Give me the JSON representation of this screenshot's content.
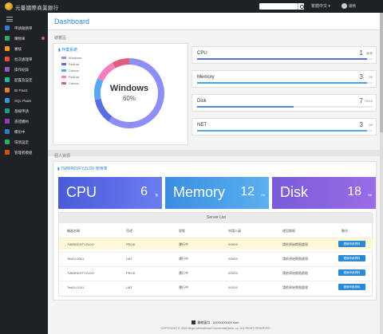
{
  "app": {
    "brand": "元臺國際商業銀行",
    "language": "繁體中文",
    "user": "總務"
  },
  "sidebar": {
    "items": [
      {
        "label": "申請服務單",
        "icon": "form-icon",
        "color": "#3a7bd5",
        "badge": false
      },
      {
        "label": "購物車",
        "icon": "cart-icon",
        "color": "#27ae60",
        "badge": true
      },
      {
        "label": "審核",
        "icon": "check-icon",
        "color": "#f39c12",
        "badge": false
      },
      {
        "label": "批次處理單",
        "icon": "batch-icon",
        "color": "#e74c3c",
        "badge": false
      },
      {
        "label": "操作紀錄",
        "icon": "history-icon",
        "color": "#9b59b6",
        "badge": false
      },
      {
        "label": "配置及設定",
        "icon": "settings-icon",
        "color": "#1abc9c",
        "badge": false
      },
      {
        "label": "BI PaaS",
        "icon": "bi-icon",
        "color": "#e67e22",
        "badge": false
      },
      {
        "label": "SQL PaaS",
        "icon": "sql-icon",
        "color": "#3498db",
        "badge": false
      },
      {
        "label": "基線申請",
        "icon": "baseline-icon",
        "color": "#16a085",
        "badge": false
      },
      {
        "label": "憑證續約",
        "icon": "cert-icon",
        "color": "#8e44ad",
        "badge": false
      },
      {
        "label": "備份中",
        "icon": "backup-icon",
        "color": "#2c80b9",
        "badge": false
      },
      {
        "label": "環境設定",
        "icon": "env-icon",
        "color": "#27ae60",
        "badge": false
      },
      {
        "label": "管理者模組",
        "icon": "admin-icon",
        "color": "#d35400",
        "badge": false
      }
    ]
  },
  "page": {
    "title": "Dashboard",
    "section1": "總覽區",
    "section2": "個人資源"
  },
  "os_card": {
    "title": "作業系統",
    "legend": [
      {
        "label": "Windows",
        "color": "#8e8ef5"
      },
      {
        "label": "Redhat",
        "color": "#5b6ee1"
      },
      {
        "label": "Centos",
        "color": "#5aa9f0"
      },
      {
        "label": "Redhat",
        "color": "#f47fc0"
      },
      {
        "label": "Centos",
        "color": "#e05d7e"
      }
    ],
    "center_label": "Windows",
    "center_pct": "60%"
  },
  "metrics": [
    {
      "name": "CPU",
      "value": "1",
      "unit": "個/核",
      "fill": 0.97,
      "color": "#5b6ee1"
    },
    {
      "name": "Memory",
      "value": "3",
      "unit": "GB",
      "fill": 0.97,
      "color": "#4aa3df"
    },
    {
      "name": "Disk",
      "value": "7",
      "unit": "TB/GB",
      "fill": 0.55,
      "color": "#4a90d9"
    },
    {
      "name": "NET",
      "value": "3",
      "unit": "GB",
      "fill": 0.97,
      "color": "#5aa9f0"
    }
  ],
  "machine": {
    "header": "TWBIRDXFYZLDX 使用率",
    "tiles": [
      {
        "name": "CPU",
        "value": "6",
        "unit": "核",
        "color_from": "#4a5bd9",
        "color_to": "#6a7df0"
      },
      {
        "name": "Memory",
        "value": "12",
        "unit": "GB",
        "color_from": "#3a8ee0",
        "color_to": "#5ab0f0"
      },
      {
        "name": "Disk",
        "value": "18",
        "unit": "GB",
        "color_from": "#7a5bd9",
        "color_to": "#9a6de6"
      }
    ]
  },
  "server_list": {
    "title": "Server List",
    "headers": [
      "機器名稱",
      "用途",
      "狀態",
      "申請人員",
      "使用期限",
      "動作"
    ],
    "rows": [
      {
        "name": "TWBIRDXFYZLDX",
        "purpose": "PROD",
        "status": "運行中",
        "applicant": "0X0X0",
        "expire": "請依原始期限處理",
        "action": "連線申請資料",
        "highlight": true
      },
      {
        "name": "Test1LLDXL",
        "purpose": "UAT",
        "status": "運行中",
        "applicant": "0X0X0",
        "expire": "請依原始期限處理",
        "action": "連線申請資料",
        "highlight": false
      },
      {
        "name": "TWBIRDXFYZLDX",
        "purpose": "PROD",
        "status": "運行中",
        "applicant": "0X0X0",
        "expire": "請依原始期限處理",
        "action": "連線申請資料",
        "highlight": false
      },
      {
        "name": "Test1LLDXL",
        "purpose": "UAT",
        "status": "運行中",
        "applicant": "0X0X0",
        "expire": "請依原始期限處理",
        "action": "連線申請資料",
        "highlight": false
      }
    ]
  },
  "footer": {
    "line1": "聯絡窗口 : XXXXXXXXX.com",
    "line2": "COPYRIGHT © 2024 Mega International Commercial Bank, co. ALL RIGHT RESERVED"
  }
}
